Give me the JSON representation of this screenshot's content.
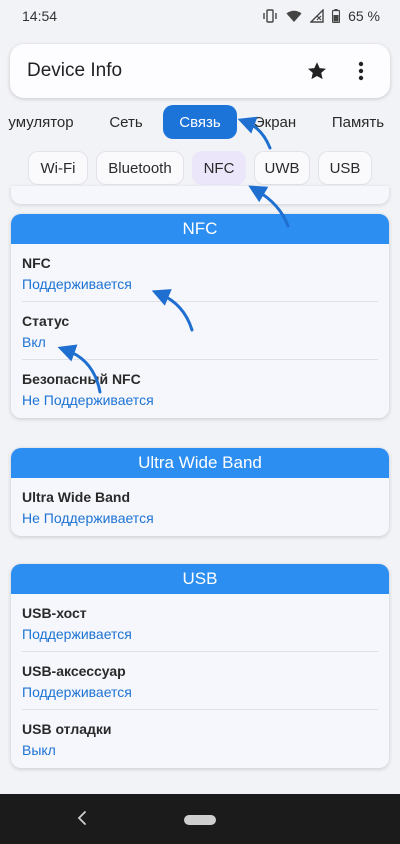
{
  "status_bar": {
    "time": "14:54",
    "battery": "65 %"
  },
  "app_bar": {
    "title": "Device Info",
    "star_icon": "star-icon",
    "menu_icon": "more-vert-icon"
  },
  "tabs": [
    {
      "label": "умулятор",
      "active": false
    },
    {
      "label": "Сеть",
      "active": false
    },
    {
      "label": "Связь",
      "active": true
    },
    {
      "label": "Экран",
      "active": false
    },
    {
      "label": "Память",
      "active": false
    }
  ],
  "chips": [
    {
      "label": "Wi-Fi",
      "active": false
    },
    {
      "label": "Bluetooth",
      "active": false
    },
    {
      "label": "NFC",
      "active": true
    },
    {
      "label": "UWB",
      "active": false
    },
    {
      "label": "USB",
      "active": false
    }
  ],
  "cards": {
    "nfc": {
      "title": "NFC",
      "rows": [
        {
          "label": "NFC",
          "value": "Поддерживается"
        },
        {
          "label": "Статус",
          "value": "Вкл"
        },
        {
          "label": "Безопасный NFC",
          "value": "Не Поддерживается"
        }
      ]
    },
    "uwb": {
      "title": "Ultra Wide Band",
      "rows": [
        {
          "label": "Ultra Wide Band",
          "value": "Не Поддерживается"
        }
      ]
    },
    "usb": {
      "title": "USB",
      "rows": [
        {
          "label": "USB-хост",
          "value": "Поддерживается"
        },
        {
          "label": "USB-аксессуар",
          "value": "Поддерживается"
        },
        {
          "label": "USB отладки",
          "value": "Выкл"
        }
      ]
    }
  },
  "colors": {
    "accent": "#1c73d8",
    "card_header": "#2c8ef0",
    "value_text": "#1d73d4",
    "annotation_arrow": "#1f6fd0"
  }
}
